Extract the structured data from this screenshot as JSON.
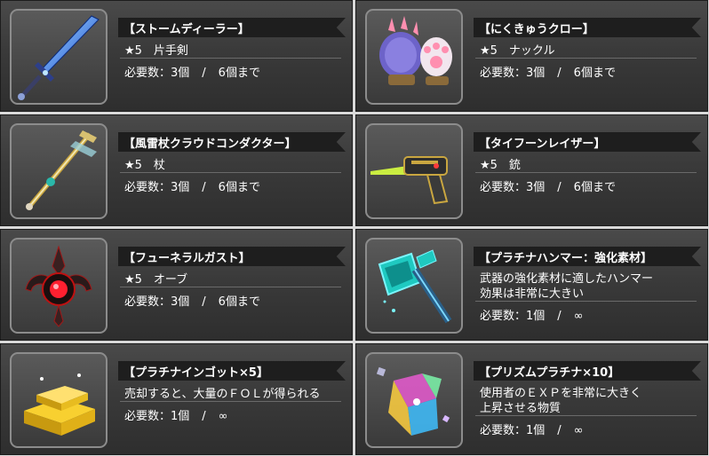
{
  "items": [
    {
      "name": "【ストームディーラー】",
      "desc": [
        "★5　片手剣"
      ],
      "req_label": "必要数：3個",
      "req_max": "6個まで"
    },
    {
      "name": "【にくきゅうクロー】",
      "desc": [
        "★5　ナックル"
      ],
      "req_label": "必要数：3個",
      "req_max": "6個まで"
    },
    {
      "name": "【風雷杖クラウドコンダクター】",
      "desc": [
        "★5　杖"
      ],
      "req_label": "必要数：3個",
      "req_max": "6個まで"
    },
    {
      "name": "【タイフーンレイザー】",
      "desc": [
        "★5　銃"
      ],
      "req_label": "必要数：3個",
      "req_max": "6個まで"
    },
    {
      "name": "【フューネラルガスト】",
      "desc": [
        "★5　オーブ"
      ],
      "req_label": "必要数：3個",
      "req_max": "6個まで"
    },
    {
      "name": "【プラチナハンマー：強化素材】",
      "desc": [
        "武器の強化素材に適したハンマー",
        "効果は非常に大きい"
      ],
      "req_label": "必要数：1個",
      "req_max": "∞"
    },
    {
      "name": "【プラチナインゴット×5】",
      "desc": [
        "売却すると、大量のＦＯＬが得られる"
      ],
      "req_label": "必要数：1個",
      "req_max": "∞"
    },
    {
      "name": "【プリズムプラチナ×10】",
      "desc": [
        "使用者のＥＸＰを非常に大きく",
        "上昇させる物質"
      ],
      "req_label": "必要数：1個",
      "req_max": "∞"
    }
  ],
  "separator": "/",
  "icons": [
    "sword-icon",
    "paw-claw-icon",
    "staff-icon",
    "gun-icon",
    "orb-icon",
    "hammer-icon",
    "gold-ingot-icon",
    "prism-crystal-icon"
  ]
}
